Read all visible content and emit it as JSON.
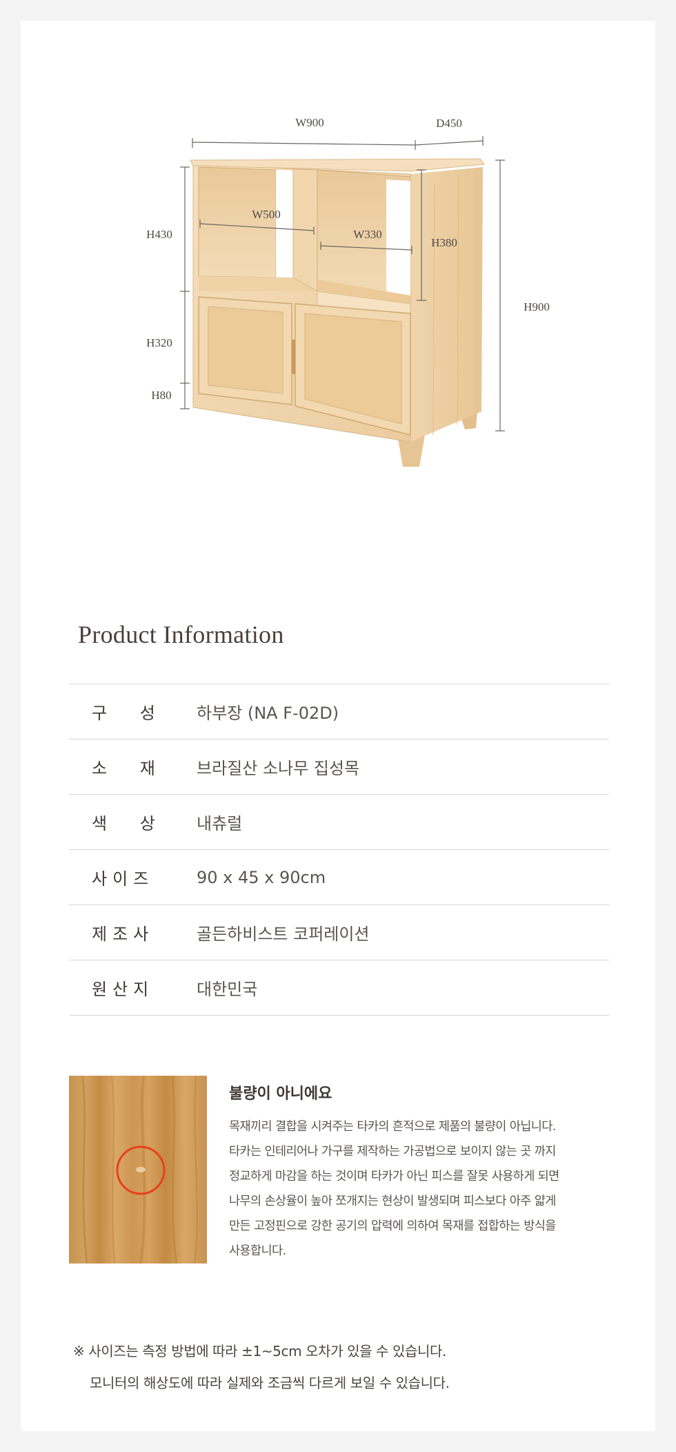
{
  "diagram": {
    "labels": {
      "w900": "W900",
      "d450": "D450",
      "h430": "H430",
      "h320": "H320",
      "h80": "H80",
      "w500": "W500",
      "w330": "W330",
      "h380": "H380",
      "h900": "H900"
    }
  },
  "info": {
    "title": "Product Information",
    "rows": [
      {
        "label": "구 성",
        "value": "하부장 (NA F-02D)"
      },
      {
        "label": "소 재",
        "value": "브라질산 소나무 집성목"
      },
      {
        "label": "색 상",
        "value": "내츄럴"
      },
      {
        "label": "사이즈",
        "value": "90 x 45 x 90cm"
      },
      {
        "label": "제조사",
        "value": "골든하비스트 코퍼레이션"
      },
      {
        "label": "원산지",
        "value": "대한민국"
      }
    ]
  },
  "note": {
    "title": "불량이 아니에요",
    "lines": [
      "목재끼리 결합을 시켜주는 타카의 흔적으로 제품의 불량이 아닙니다.",
      "타카는 인테리어나 가구를 제작하는 가공법으로 보이지 않는 곳 까지",
      "정교하게 마감을 하는 것이며 타카가 아닌 피스를 잘못 사용하게 되면",
      "나무의 손상율이 높아 쪼개지는 현상이 발생되며 피스보다 아주 얇게",
      "만든 고정핀으로 강한 공기의 압력에 의하여 목재를 접합하는 방식을",
      "사용합니다."
    ],
    "marker_color": "#e8401c"
  },
  "footnote": {
    "line1": "※ 사이즈는 측정 방법에 따라 ±1~5cm 오차가 있을 수 있습니다.",
    "line2": "모니터의 해상도에 따라 실제와 조금씩 다르게 보일 수 있습니다."
  },
  "colors": {
    "wood_light": "#f2dcbc",
    "wood_mid": "#e8c99b",
    "wood_dark": "#d4ac74",
    "line": "#6b6461"
  }
}
